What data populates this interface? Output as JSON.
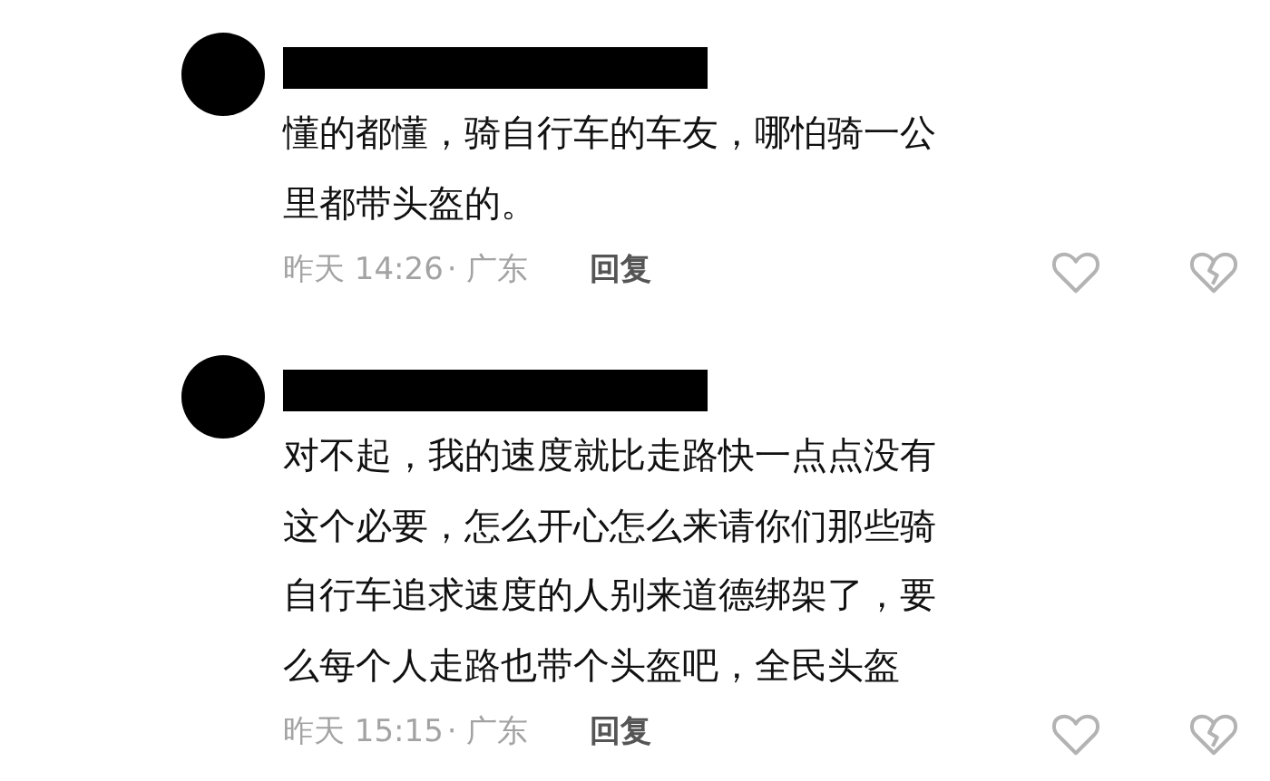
{
  "comments": [
    {
      "text_lines": [
        "懂的都懂，骑自行车的车友，哪怕骑一公",
        "里都带头盔的。"
      ],
      "time": "昨天 14:26",
      "location": "· 广东",
      "reply": "回复"
    },
    {
      "text_lines": [
        "对不起，我的速度就比走路快一点点没有",
        "这个必要，怎么开心怎么来请你们那些骑",
        "自行车追求速度的人别来道德绑架了，要",
        "么每个人走路也带个头盔吧，全民头盔"
      ],
      "time": "昨天 15:15",
      "location": "· 广东",
      "reply": "回复"
    }
  ]
}
